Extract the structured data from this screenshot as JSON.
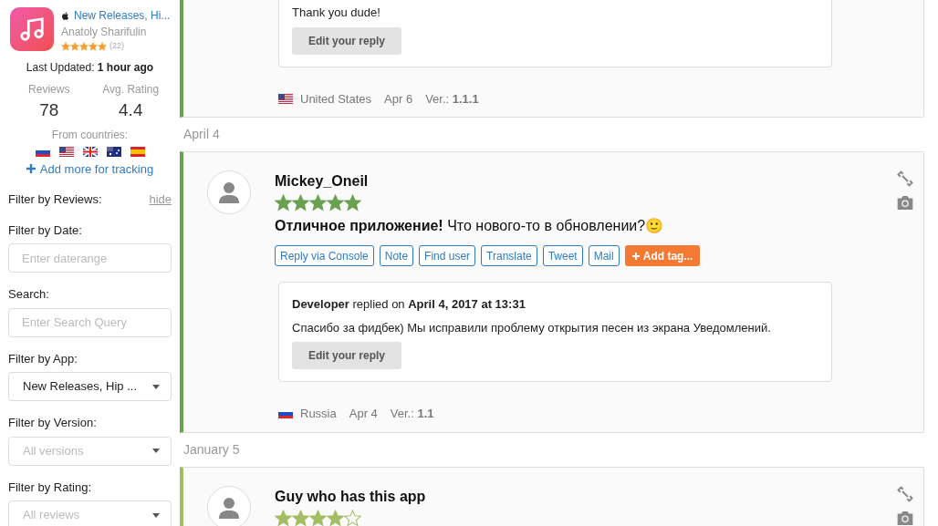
{
  "app": {
    "name": "New Releases, Hi...",
    "developer": "Anatoly Sharifulin",
    "stars": 5,
    "rating_count": "(22)"
  },
  "last_updated": {
    "label": "Last Updated:",
    "value": "1 hour ago"
  },
  "stats": [
    {
      "label": "Reviews",
      "value": "78"
    },
    {
      "label": "Avg. Rating",
      "value": "4.4"
    }
  ],
  "countries": {
    "label": "From countries:",
    "flags": [
      {
        "kind": "ru"
      },
      {
        "kind": "us"
      },
      {
        "kind": "gb"
      },
      {
        "kind": "au"
      },
      {
        "kind": "es"
      }
    ],
    "add_link": "Add more for tracking"
  },
  "filters": {
    "title": "Filter by Reviews:",
    "hide_link": "hide",
    "fields": [
      {
        "kind": "input",
        "label": "Filter by Date:",
        "placeholder": "Enter daterange"
      },
      {
        "kind": "input",
        "label": "Search:",
        "placeholder": "Enter Search Query"
      },
      {
        "kind": "select",
        "label": "Filter by App:",
        "value": "New Releases, Hip ...",
        "disabled": false
      },
      {
        "kind": "select",
        "label": "Filter by Version:",
        "value": "All versions",
        "disabled": true
      },
      {
        "kind": "select",
        "label": "Filter by Rating:",
        "value": "All reviews",
        "disabled": true
      }
    ]
  },
  "reviews": [
    {
      "partial": true,
      "color": "#6aa150",
      "reply": {
        "text": "Thank you dude!",
        "button": "Edit your reply"
      },
      "footer": {
        "flag": {
          "kind": "us"
        },
        "country": "United States",
        "date": "Apr 6",
        "version_label": "Ver.:",
        "version": "1.1.1"
      }
    },
    {
      "partial": false,
      "date_heading": "April 4",
      "color": "#6aa150",
      "author": "Mickey_Oneil",
      "stars": 5,
      "text": "**Отличное приложение!** Что нового-то в обновлении?🙂",
      "actions": [
        "Reply via Console",
        "Note",
        "Find user",
        "Translate",
        "Tweet",
        "Mail"
      ],
      "add_tag": "Add tag...",
      "reply": {
        "author": "Developer",
        "replied_on": "replied on",
        "date": "April 4, 2017 at 13:31",
        "text": "Спасибо за фидбек) Мы исправили проблему открытия песен из экрана Уведомлений.",
        "button": "Edit your reply"
      },
      "footer": {
        "flag": {
          "kind": "ru"
        },
        "country": "Russia",
        "date": "Apr 4",
        "version_label": "Ver.:",
        "version": "1.1"
      }
    },
    {
      "partial": false,
      "date_heading": "January 5",
      "color": "#a3bd62",
      "author": "Guy who has this app",
      "stars": 4
    }
  ]
}
